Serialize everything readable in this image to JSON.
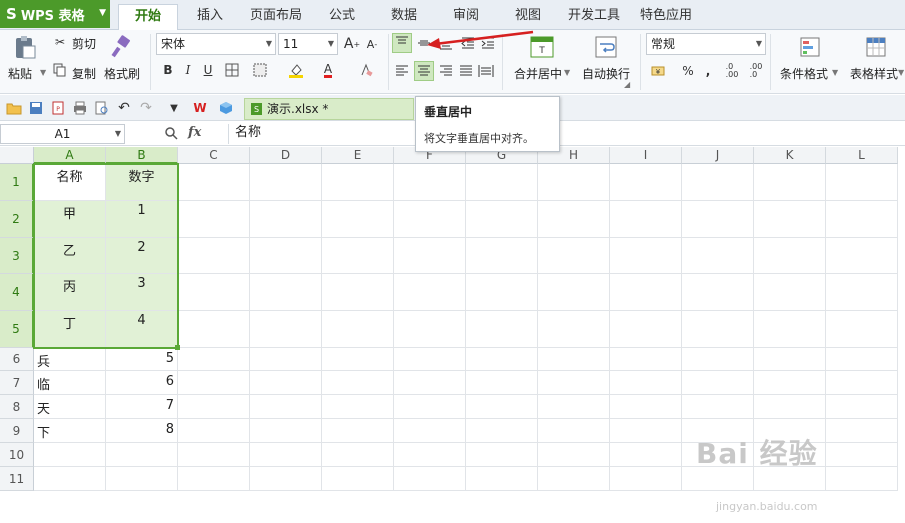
{
  "app": {
    "logo": "S",
    "name": "WPS 表格"
  },
  "tabs": [
    "开始",
    "插入",
    "页面布局",
    "公式",
    "数据",
    "审阅",
    "视图",
    "开发工具",
    "特色应用"
  ],
  "ribbon": {
    "clipboard": {
      "paste": "粘贴",
      "cut": "剪切",
      "copy": "复制",
      "format_painter": "格式刷"
    },
    "font": {
      "name": "宋体",
      "size": "11",
      "bold": "B",
      "italic": "I",
      "underline": "U",
      "font_color": "A"
    },
    "alignment": {
      "merge_center": "合并居中",
      "wrap_text": "自动换行"
    },
    "number": {
      "format": "常规",
      "percent": "%",
      "comma": ","
    },
    "styles": {
      "conditional_format": "条件格式",
      "table_style": "表格样式"
    }
  },
  "doc_tab": "演示.xlsx *",
  "tooltip": {
    "title": "垂直居中",
    "desc": "将文字垂直居中对齐。"
  },
  "formula_bar": {
    "name_box": "A1",
    "fx": "fx",
    "content": "名称"
  },
  "columns": [
    "A",
    "B",
    "C",
    "D",
    "E",
    "F",
    "G",
    "H",
    "I",
    "J",
    "K",
    "L"
  ],
  "rows": [
    "1",
    "2",
    "3",
    "4",
    "5",
    "6",
    "7",
    "8",
    "9",
    "10",
    "11"
  ],
  "cells": {
    "A1": "名称",
    "B1": "数字",
    "A2": "甲",
    "B2": "1",
    "A3": "乙",
    "B3": "2",
    "A4": "丙",
    "B4": "3",
    "A5": "丁",
    "B5": "4",
    "A6": "兵",
    "B6": "5",
    "A7": "临",
    "B7": "6",
    "A8": "天",
    "B8": "7",
    "A9": "下",
    "B9": "8"
  },
  "watermark": {
    "brand": "Bai 经验",
    "url": "jingyan.baidu.com"
  },
  "colors": {
    "accent": "#4c9a2a",
    "selection": "#5aa837",
    "selection_fill": "#e1f1d6",
    "arrow": "#d62020"
  }
}
